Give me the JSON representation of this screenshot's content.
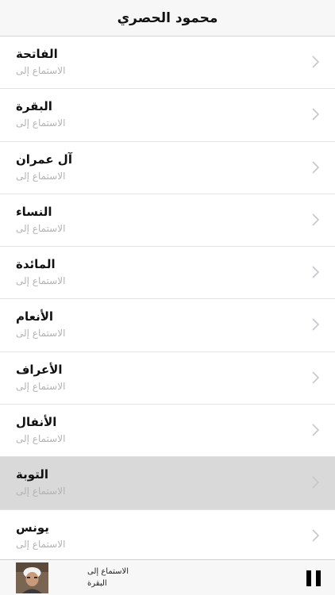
{
  "header": {
    "title": "محمود الحصري"
  },
  "list": {
    "items": [
      {
        "name": "الفاتحة",
        "subtitle": "الاستماع إلى",
        "selected": false
      },
      {
        "name": "البقرة",
        "subtitle": "الاستماع إلى",
        "selected": false
      },
      {
        "name": "آل عمران",
        "subtitle": "الاستماع إلى",
        "selected": false
      },
      {
        "name": "النساء",
        "subtitle": "الاستماع إلى",
        "selected": false
      },
      {
        "name": "المائدة",
        "subtitle": "الاستماع إلى",
        "selected": false
      },
      {
        "name": "الأنعام",
        "subtitle": "الاستماع إلى",
        "selected": false
      },
      {
        "name": "الأعراف",
        "subtitle": "الاستماع إلى",
        "selected": false
      },
      {
        "name": "الأنفال",
        "subtitle": "الاستماع إلى",
        "selected": false
      },
      {
        "name": "التوبة",
        "subtitle": "الاستماع إلى",
        "selected": true
      },
      {
        "name": "يونس",
        "subtitle": "الاستماع إلى",
        "selected": false
      }
    ]
  },
  "player": {
    "title": "الاستماع إلى",
    "subtitle": "البقرة",
    "artwork_icon": "reciter-portrait",
    "control_icon": "pause-icon"
  },
  "colors": {
    "selected_row": "#d9d9d9",
    "subtitle_text": "#b3b3b3",
    "chevron": "#c7c7cc",
    "bar_background": "#f7f7f7"
  }
}
